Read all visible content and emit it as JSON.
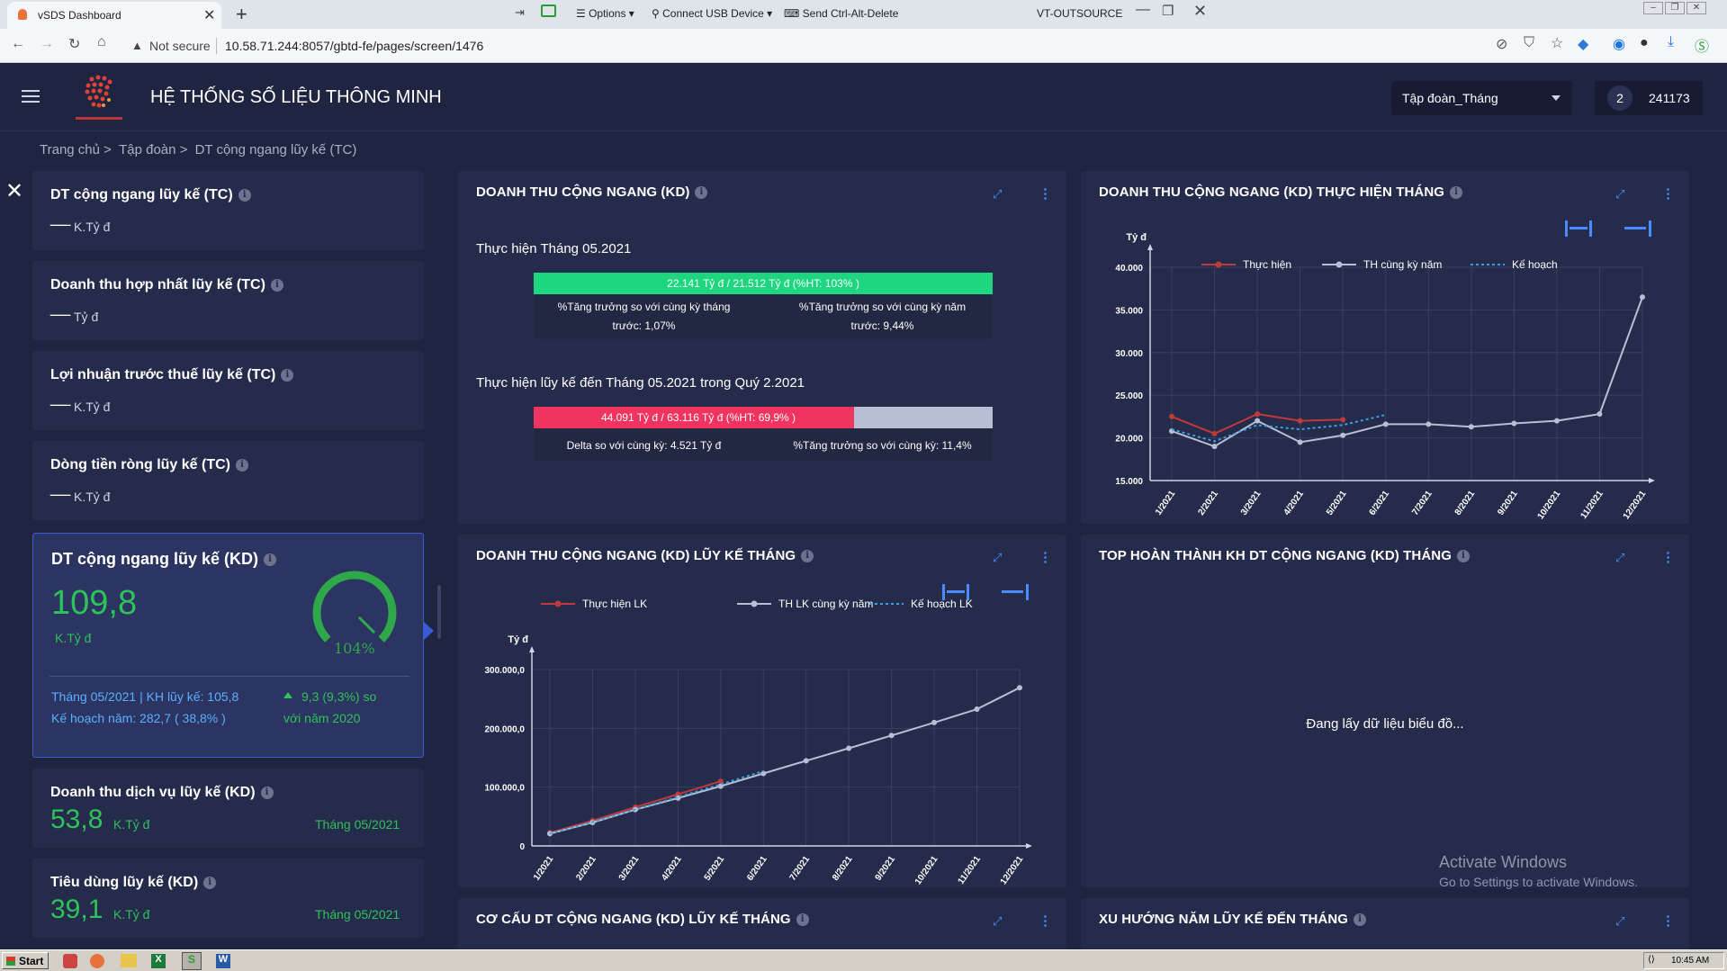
{
  "browser": {
    "tab_title": "vSDS Dashboard",
    "new_tab": "+",
    "vm_toolbar": {
      "options": "Options",
      "usb": "Connect USB Device",
      "cad": "Send Ctrl-Alt-Delete",
      "host": "VT-OUTSOURCE"
    },
    "security": "Not secure",
    "url": "10.58.71.244:8057/gbtd-fe/pages/screen/1476"
  },
  "header": {
    "title": "HỆ THỐNG SỐ LIỆU THÔNG MINH",
    "select_value": "Tập đoàn_Tháng",
    "avatar_text": "2",
    "user_id": "241173"
  },
  "breadcrumb": {
    "home": "Trang chủ >",
    "group": "Tập đoàn >",
    "current": "DT cộng ngang lũy kế (TC)"
  },
  "kpis": [
    {
      "title": "DT cộng ngang lũy kế (TC)",
      "value": "__",
      "unit": "K.Tỷ đ"
    },
    {
      "title": "Doanh thu hợp nhất lũy kế (TC)",
      "value": "__",
      "unit": "Tỷ đ"
    },
    {
      "title": "Lợi nhuận trước thuế lũy kế (TC)",
      "value": "__",
      "unit": "K.Tỷ đ"
    },
    {
      "title": "Dòng tiền ròng lũy kế (TC)",
      "value": "__",
      "unit": "K.Tỷ đ"
    }
  ],
  "kpi_active": {
    "title": "DT cộng ngang lũy kế (KD)",
    "value": "109,8",
    "unit": "K.Tỷ đ",
    "gauge_label": "104%",
    "gauge_fraction": 1.04,
    "line1": "Tháng 05/2021 | KH lũy kế: 105,8",
    "line2": "Kế hoạch năm: 282,7 ( 38,8% )",
    "growth1": "9,3 (9,3%) so",
    "growth2": "với năm 2020"
  },
  "kpis_bottom": [
    {
      "title": "Doanh thu dịch vụ lũy kế (KD)",
      "value": "53,8",
      "unit": "K.Tỷ đ",
      "period": "Tháng 05/2021"
    },
    {
      "title": "Tiêu dùng lũy kế (KD)",
      "value": "39,1",
      "unit": "K.Tỷ đ",
      "period": "Tháng 05/2021"
    }
  ],
  "panel1": {
    "title": "DOANH THU CỘNG NGANG (KD)",
    "sub1": "Thực hiện Tháng 05.2021",
    "bar1_text": "22.141 Tỷ đ / 21.512 Tỷ đ (%HT: 103% )",
    "bar1_fraction": 1.0,
    "stat1a": "%Tăng trưởng so với cùng kỳ tháng",
    "stat1b": "trước: 1,07%",
    "stat2a": "%Tăng trưởng so với cùng kỳ năm",
    "stat2b": "trước: 9,44%",
    "sub2": "Thực hiện lũy kế đến Tháng 05.2021 trong Quý 2.2021",
    "bar2_text": "44.091 Tỷ đ / 63.116 Tỷ đ (%HT: 69,9% )",
    "bar2_fraction": 0.699,
    "stat3": "Delta so với cùng kỳ: 4.521 Tỷ đ",
    "stat4": "%Tăng trưởng so với cùng kỳ: 11,4%"
  },
  "panel2": {
    "title": "DOANH THU CỘNG NGANG (KD) THỰC HIỆN THÁNG"
  },
  "panel3": {
    "title": "DOANH THU CỘNG NGANG (KD) LŨY KẾ THÁNG"
  },
  "panel4": {
    "title": "TOP HOÀN THÀNH KH DT CỘNG NGANG (KD) THÁNG",
    "loading": "Đang lấy dữ liệu biểu đồ..."
  },
  "panel5": {
    "title": "CƠ CẤU DT CỘNG NGANG (KD) LŨY KẾ THÁNG"
  },
  "panel6": {
    "title": "XU HƯỚNG NĂM LŨY KẾ ĐẾN THÁNG"
  },
  "watermark": {
    "line1": "Activate Windows",
    "line2": "Go to Settings to activate Windows."
  },
  "taskbar": {
    "start": "Start",
    "clock": "10:45 AM"
  },
  "colors": {
    "accent_red": "#c0393b",
    "accent_gray": "#b8bed3",
    "accent_blue": "#3aa0e0",
    "bar_green": "#1ed67f",
    "bar_red": "#f0345f",
    "gauge_green": "#2ea84a"
  },
  "chart_data": [
    {
      "type": "line",
      "ylabel": "Tỷ đ",
      "categories": [
        "1/2021",
        "2/2021",
        "3/2021",
        "4/2021",
        "5/2021",
        "6/2021",
        "7/2021",
        "8/2021",
        "9/2021",
        "10/2021",
        "11/2021",
        "12/2021"
      ],
      "yticks": [
        "40.000",
        "35.000",
        "30.000",
        "25.000",
        "20.000",
        "15.000"
      ],
      "ylim": [
        15000,
        40000
      ],
      "grid": true,
      "legend_position": "top",
      "series": [
        {
          "name": "Thực hiện",
          "values": [
            22500,
            20500,
            22800,
            22000,
            22141
          ]
        },
        {
          "name": "TH cùng kỳ năm",
          "values": [
            20800,
            19000,
            22000,
            19500,
            20300,
            21600,
            21600,
            21300,
            21700,
            22000,
            22800,
            36500
          ]
        },
        {
          "name": "Kế hoạch",
          "values": [
            21000,
            19600,
            21500,
            21000,
            21512,
            22700
          ]
        }
      ]
    },
    {
      "type": "line",
      "ylabel": "Tỷ đ",
      "categories": [
        "1/2021",
        "2/2021",
        "3/2021",
        "4/2021",
        "5/2021",
        "6/2021",
        "7/2021",
        "8/2021",
        "9/2021",
        "10/2021",
        "11/2021",
        "12/2021"
      ],
      "yticks": [
        "300.000,0",
        "200.000,0",
        "100.000,0",
        "0"
      ],
      "ylim": [
        0,
        300000
      ],
      "grid": true,
      "legend_position": "top",
      "series": [
        {
          "name": "Thực hiện LK",
          "values": [
            22500,
            43000,
            65800,
            87800,
            109900
          ]
        },
        {
          "name": "TH LK cùng kỳ năm",
          "values": [
            20800,
            39800,
            61800,
            81300,
            101600,
            123200,
            144800,
            166100,
            187800,
            209800,
            232600,
            269100
          ]
        },
        {
          "name": "Kế hoạch LK",
          "values": [
            21000,
            40600,
            62100,
            83100,
            104600,
            127300
          ]
        }
      ]
    }
  ]
}
